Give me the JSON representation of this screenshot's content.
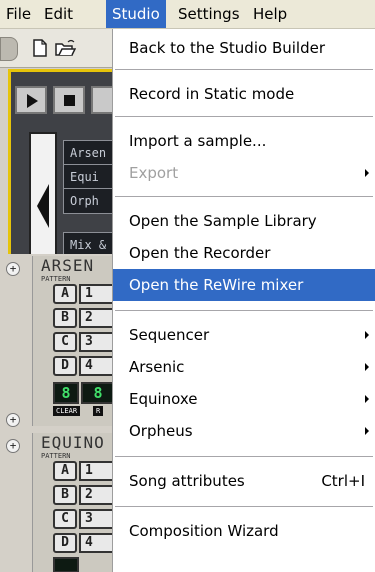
{
  "menubar": {
    "items": [
      "File",
      "Edit",
      "Studio",
      "Settings",
      "Help"
    ],
    "active": "Studio",
    "active_color": "#316ac5"
  },
  "app": {
    "display_items": [
      "Arsen",
      "Equi",
      "Orph",
      "Mix &"
    ],
    "instruments": [
      {
        "title": "ARSEN",
        "pattern_label": "PATTERN",
        "pads": [
          "A",
          "B",
          "C",
          "D"
        ],
        "numbers": [
          "1",
          "2",
          "3",
          "4"
        ],
        "display_a": "8",
        "display_b": "8",
        "clear_label": "CLEAR",
        "r_label": "R"
      },
      {
        "title": "EQUINO",
        "pattern_label": "PATTERN",
        "pads": [
          "A",
          "B",
          "C",
          "D"
        ],
        "numbers": [
          "1",
          "2",
          "3",
          "4"
        ]
      }
    ],
    "expand_symbol": "+",
    "transport_icons": [
      "play-icon",
      "stop-icon"
    ],
    "toolbar_icons": [
      "new-document-icon",
      "open-folder-icon"
    ]
  },
  "studio_menu": {
    "items": [
      {
        "label": "Back to the Studio Builder"
      },
      {
        "label": "Record in Static mode"
      },
      {
        "label": "Import a sample..."
      },
      {
        "label": "Export",
        "disabled": true,
        "submenu": true
      },
      {
        "label": "Open the Sample Library"
      },
      {
        "label": "Open the Recorder"
      },
      {
        "label": "Open the ReWire mixer",
        "highlighted": true
      },
      {
        "label": "Sequencer",
        "submenu": true
      },
      {
        "label": "Arsenic",
        "submenu": true
      },
      {
        "label": "Equinoxe",
        "submenu": true
      },
      {
        "label": "Orpheus",
        "submenu": true
      },
      {
        "label": "Song attributes",
        "shortcut": "Ctrl+I"
      },
      {
        "label": "Composition Wizard"
      }
    ],
    "highlight_color": "#316ac5",
    "disabled_color": "#a0a0a0"
  }
}
